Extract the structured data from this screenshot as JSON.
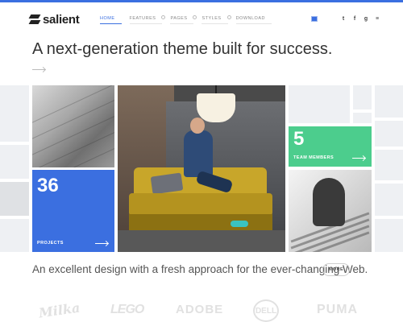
{
  "header": {
    "logo_text": "salient",
    "nav": [
      {
        "label": "HOME",
        "active": true,
        "has_dropdown": false
      },
      {
        "label": "FEATURES",
        "active": false,
        "has_dropdown": true
      },
      {
        "label": "PAGES",
        "active": false,
        "has_dropdown": true
      },
      {
        "label": "STYLES",
        "active": false,
        "has_dropdown": true
      },
      {
        "label": "DOWNLOAD",
        "active": false,
        "has_dropdown": false
      }
    ],
    "social": [
      {
        "icon": "twitter-icon",
        "glyph": "t"
      },
      {
        "icon": "facebook-icon",
        "glyph": "f"
      },
      {
        "icon": "google-plus-icon",
        "glyph": "g"
      },
      {
        "icon": "rss-icon",
        "glyph": "≡"
      }
    ]
  },
  "hero": {
    "title": "A next-generation theme built for success."
  },
  "stats": {
    "projects": {
      "number": "36",
      "label": "PROJECTS"
    },
    "team": {
      "number": "5",
      "label": "TEAM MEMBERS"
    }
  },
  "tagline": {
    "text": "An excellent design with a fresh approach for the ever-changing Web.",
    "button": "MORE"
  },
  "brands": [
    "Milka",
    "LEGO",
    "ADOBE",
    "DELL",
    "PUMA"
  ],
  "colors": {
    "accent": "#3b6fe0",
    "green": "#4ccd8d",
    "tile": "#eef0f3"
  }
}
